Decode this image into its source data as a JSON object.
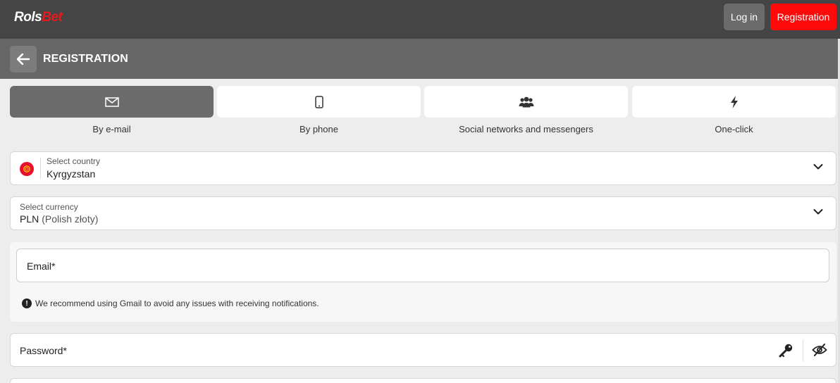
{
  "brand": {
    "part1": "Rols",
    "part2": "Bet"
  },
  "topbar": {
    "login_label": "Log in",
    "register_label": "Registration"
  },
  "header": {
    "title": "REGISTRATION"
  },
  "tabs": [
    {
      "label": "By e-mail",
      "icon": "envelope-icon",
      "active": true
    },
    {
      "label": "By phone",
      "icon": "phone-icon",
      "active": false
    },
    {
      "label": "Social networks and messengers",
      "icon": "users-icon",
      "active": false
    },
    {
      "label": "One-click",
      "icon": "bolt-icon",
      "active": false
    }
  ],
  "country": {
    "label": "Select country",
    "value": "Kyrgyzstan"
  },
  "currency": {
    "label": "Select currency",
    "code": "PLN",
    "name": "(Polish złoty)"
  },
  "email": {
    "placeholder": "Email*",
    "notice": "We recommend using Gmail to avoid any issues with receiving notifications."
  },
  "password": {
    "placeholder": "Password*"
  },
  "colors": {
    "accent": "#ff0a0a",
    "topbar": "#454545",
    "header": "#666666",
    "active_tab": "#6b6b6b"
  }
}
